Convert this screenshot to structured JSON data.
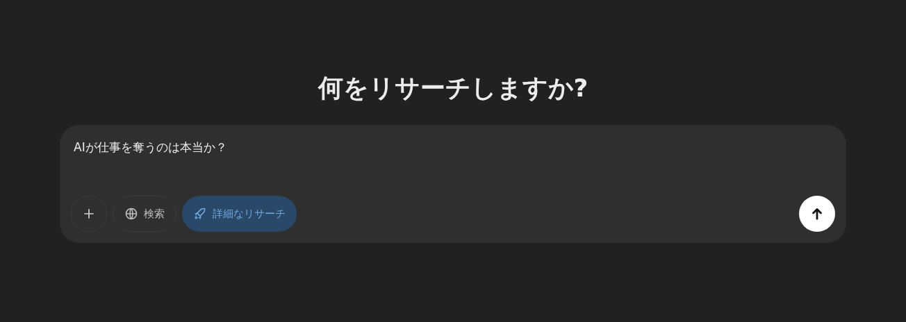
{
  "heading": "何をリサーチしますか?",
  "prompt": {
    "value": "AIが仕事を奪うのは本当か？"
  },
  "tools": [
    {
      "kind": "search",
      "label": "検索",
      "selected": false
    },
    {
      "kind": "research",
      "label": "詳細なリサーチ",
      "selected": true
    }
  ]
}
